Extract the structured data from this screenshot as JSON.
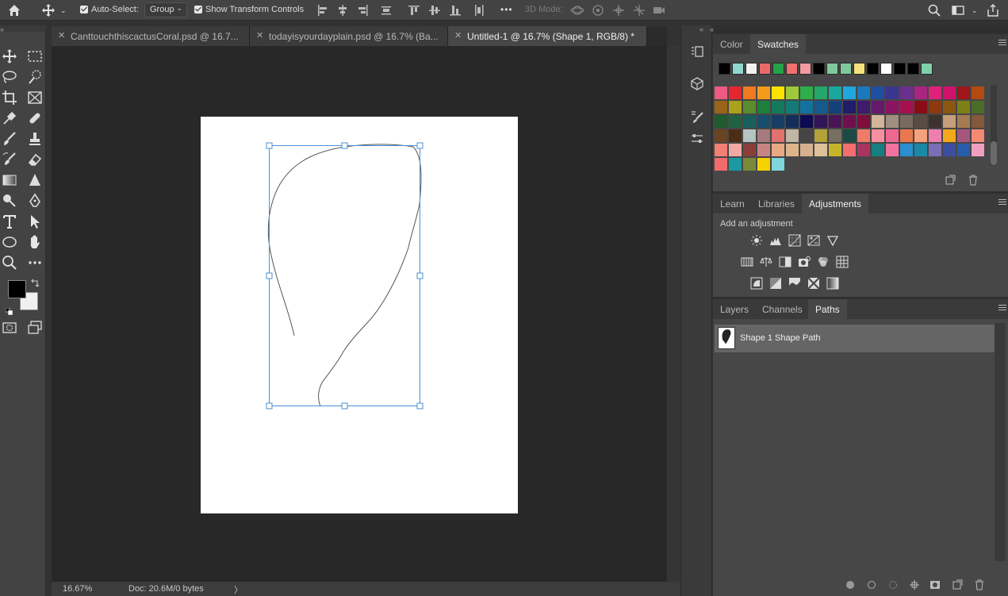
{
  "optionsbar": {
    "auto_select_label": "Auto-Select:",
    "auto_select_value": "Group",
    "show_transform_label": "Show Transform Controls",
    "more_label": "•••",
    "mode_3d_label": "3D Mode:"
  },
  "tabs": [
    {
      "label": "CanttouchthiscactusCoral.psd @ 16.7..."
    },
    {
      "label": "todayisyourdayplain.psd @ 16.7% (Ba..."
    },
    {
      "label": "Untitled-1 @ 16.7% (Shape 1, RGB/8) *"
    }
  ],
  "tab_close": "✕",
  "statusbar": {
    "zoom": "16.67%",
    "doc": "Doc: 20.6M/0 bytes",
    "arrow": "〉"
  },
  "color_panel": {
    "tabs": [
      "Color",
      "Swatches"
    ],
    "active_tab": "Swatches",
    "recent_swatches": [
      "#000000",
      "#8fd8cf",
      "#f2f2f2",
      "#e86a6a",
      "#27a04a",
      "#f07070",
      "#f29aa0",
      "#000000",
      "#7fc99a",
      "#7fc99a",
      "#f5e27a",
      "#000000",
      "#ffffff",
      "#000000",
      "#000000",
      "#7fd0a8"
    ],
    "swatch_rows": [
      [
        "#ee5a84",
        "#e4262f",
        "#f07b1e",
        "#f49b1b",
        "#ffe200",
        "#9ec93b",
        "#2fae4a",
        "#25a76a",
        "#19a89b",
        "#1fa6dd",
        "#1b78bf",
        "#1e4fa0",
        "#3a3591",
        "#6b2f8d",
        "#a9257f",
        "#e1207b",
        "#d2126a",
        "#9f1519",
        "#b34a12"
      ],
      [
        "#9a6518",
        "#aaa21a",
        "#5a8d2c",
        "#1d7f3b",
        "#147a5c",
        "#137a78",
        "#11729e",
        "#155a8d",
        "#16407a",
        "#201d6b",
        "#3f1b6c",
        "#66196a",
        "#8c1360",
        "#a5104e",
        "#8a0c17",
        "#8e380e",
        "#8b5713",
        "#7d7f17",
        "#4b6d27"
      ],
      [
        "#1f5b2f",
        "#1f6241",
        "#185f5e",
        "#164f6e",
        "#163d65",
        "#142d5a",
        "#0e0b53",
        "#321458",
        "#4a1455",
        "#6f0f4e",
        "#7f0d3c",
        "#d2b59a",
        "#a08f7f",
        "#7a6a5e",
        "#5a4c43",
        "#3d332d",
        "#c79f7a",
        "#a67b52",
        "#84583a"
      ],
      [
        "#6a4323",
        "#4b2c15",
        "#b7c3c1",
        "#a77a7e",
        "#e2726d",
        "#bfb7a4",
        "#454545",
        "#b3a23a",
        "#767063",
        "#1b4a46",
        "#ef7b6b",
        "#f78fa0",
        "#f06791",
        "#e9784e",
        "#f5a17b",
        "#ec7fae",
        "#f4a81b",
        "#a5567f",
        "#f58a72"
      ],
      [
        "#f37e74",
        "#f1a9a4",
        "#8a3e3a",
        "#c88484",
        "#e8a984",
        "#ddb48c",
        "#d7b18f",
        "#dec09a",
        "#c5b52b",
        "#f36e6e",
        "#a83560",
        "#177f7f",
        "#f0729e",
        "#2a8ed0",
        "#1a8aa4",
        "#7a6fb6",
        "#3c4f9e",
        "#295cab",
        "#efa0c0"
      ],
      [
        "#f26b6b",
        "#1a9aa0",
        "#7a8a3a",
        "#f5d200",
        "#7fd6dc"
      ]
    ]
  },
  "adjust_panel": {
    "tabs": [
      "Learn",
      "Libraries",
      "Adjustments"
    ],
    "active_tab": "Adjustments",
    "add_label": "Add an adjustment",
    "icons_row1": [
      "brightness-icon",
      "levels-icon",
      "curves-icon",
      "exposure-icon",
      "vibrance-icon"
    ],
    "icons_row2": [
      "hue-saturation-icon",
      "color-balance-icon",
      "black-white-icon",
      "photo-filter-icon",
      "channel-mixer-icon",
      "color-lookup-icon"
    ],
    "icons_row3": [
      "invert-icon",
      "posterize-icon",
      "threshold-icon",
      "selective-color-icon",
      "gradient-map-icon"
    ]
  },
  "layers_panel": {
    "tabs": [
      "Layers",
      "Channels",
      "Paths"
    ],
    "active_tab": "Paths",
    "path_name": "Shape 1 Shape Path"
  },
  "colors": {
    "accent": "#4a8fd6",
    "canvas_bg": "#282828",
    "panel_bg": "#474747"
  }
}
